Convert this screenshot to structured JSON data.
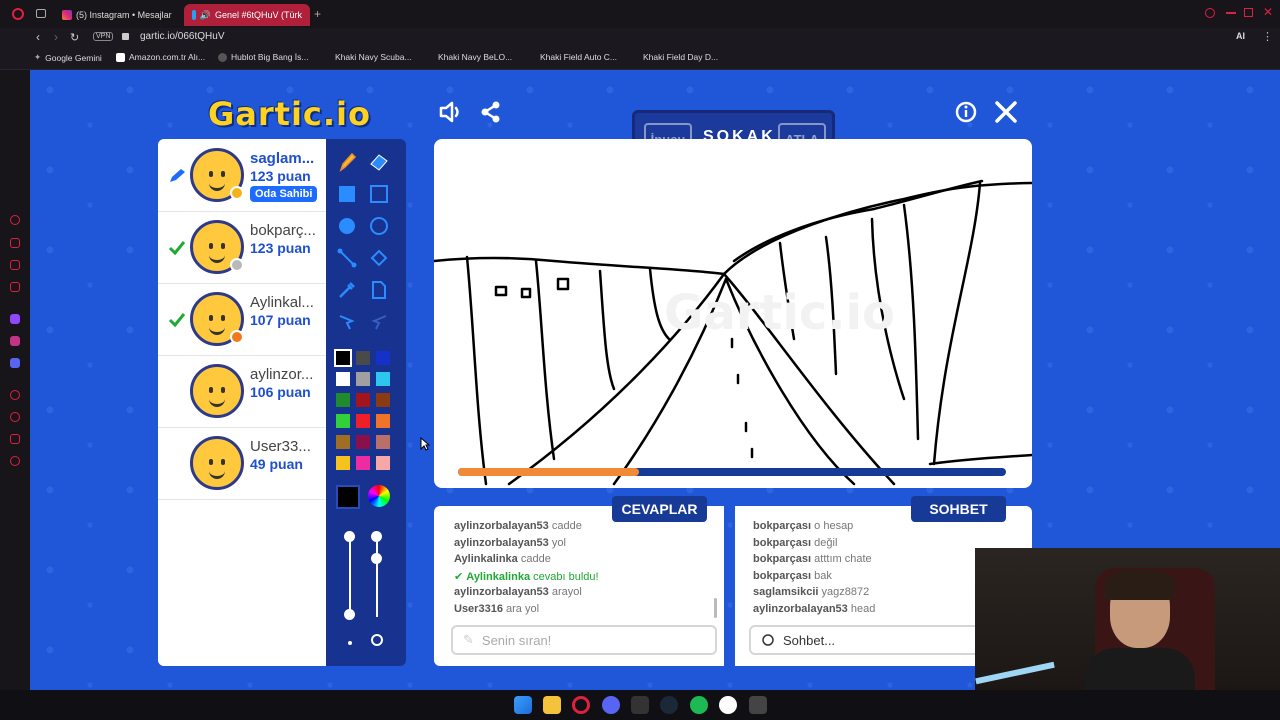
{
  "browser": {
    "tabs": [
      {
        "label": "(5) Instagram • Mesajlar"
      },
      {
        "label": "Genel #6tQHuV (Türk"
      }
    ],
    "url": "gartic.io/066tQHuV",
    "vpn_label": "VPN",
    "bookmarks": [
      "Google Gemini",
      "Amazon.com.tr Alı...",
      "Hublot Big Bang İs...",
      "Khaki Navy Scuba...",
      "Khaki Navy BeLO...",
      "Khaki Field Auto C...",
      "Khaki Field Day D..."
    ],
    "ai_label": "AI"
  },
  "game": {
    "logo": "Gartic.io",
    "word_panel": {
      "hint": "İpucu",
      "word": "SOKAK",
      "skip": "ATLA"
    },
    "timer_progress": 0.33,
    "players": [
      {
        "name": "saglam...",
        "score": "123 puan",
        "badge": "Oda Sahibi",
        "status_color": "#f5b21b",
        "role": "drawing"
      },
      {
        "name": "bokparç...",
        "score": "123 puan",
        "status_color": "#b9b9b9",
        "role": "guessed"
      },
      {
        "name": "Aylinkal...",
        "score": "107 puan",
        "status_color": "#f07a1b",
        "role": "guessed"
      },
      {
        "name": "aylinzor...",
        "score": "106 puan",
        "role": "none"
      },
      {
        "name": "User33...",
        "score": "49 puan",
        "role": "none"
      }
    ],
    "palette": [
      "#000000",
      "#4a4a4a",
      "#1532c8",
      "#ffffff",
      "#a0a0a0",
      "#2cc6ee",
      "#1f8a2e",
      "#a3141c",
      "#8a3b14",
      "#32d03b",
      "#ee1f26",
      "#f0732a",
      "#a06e22",
      "#8a0f4a",
      "#b9706a",
      "#f6c21f",
      "#ee2ca1",
      "#f6a8a8"
    ],
    "answers_title": "CEVAPLAR",
    "chat_title": "SOHBET",
    "answers": [
      {
        "user": "aylinzorbalayan53",
        "text": "cadde"
      },
      {
        "user": "aylinzorbalayan53",
        "text": "yol"
      },
      {
        "user": "Aylinkalinka",
        "text": "cadde"
      },
      {
        "user": "Aylinkalinka",
        "text": "cevabı buldu!",
        "correct": true
      },
      {
        "user": "aylinzorbalayan53",
        "text": "arayol"
      },
      {
        "user": "User3316",
        "text": "ara yol"
      }
    ],
    "chat": [
      {
        "user": "bokparçası",
        "text": "o hesap"
      },
      {
        "user": "bokparçası",
        "text": "değil"
      },
      {
        "user": "bokparçası",
        "text": "atttım chate"
      },
      {
        "user": "bokparçası",
        "text": "bak"
      },
      {
        "user": "saglamsikcii",
        "text": "yagz8872"
      },
      {
        "user": "aylinzorbalayan53",
        "text": "head"
      }
    ],
    "answer_placeholder": "Senin sıran!",
    "chat_placeholder": "Sohbet..."
  },
  "taskbar": {
    "icons": [
      "windows-icon",
      "files-icon",
      "opera-icon",
      "discord-icon",
      "app-icon",
      "steam-icon",
      "spotify-icon",
      "github-icon",
      "epic-icon"
    ]
  }
}
